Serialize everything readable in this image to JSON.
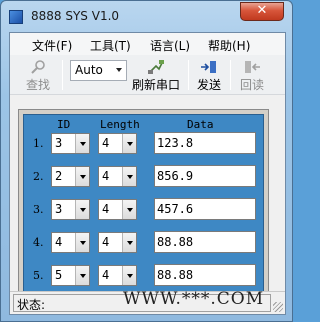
{
  "window": {
    "title": "8888 SYS V1.0",
    "close_glyph": "✕"
  },
  "menu": {
    "items": [
      "文件(F)",
      "工具(T)",
      "语言(L)",
      "帮助(H)"
    ]
  },
  "toolbar": {
    "find_label": "查找",
    "baud_value": "Auto",
    "refresh_label": "刷新串口",
    "send_label": "发送",
    "readback_label": "回读"
  },
  "table": {
    "headers": {
      "id": "ID",
      "length": "Length",
      "data": "Data"
    },
    "rows": [
      {
        "num": "1.",
        "id": "3",
        "length": "4",
        "data": "123.8"
      },
      {
        "num": "2.",
        "id": "2",
        "length": "4",
        "data": "856.9"
      },
      {
        "num": "3.",
        "id": "3",
        "length": "4",
        "data": "457.6"
      },
      {
        "num": "4.",
        "id": "4",
        "length": "4",
        "data": "88.88"
      },
      {
        "num": "5.",
        "id": "5",
        "length": "4",
        "data": "88.88"
      }
    ]
  },
  "status": {
    "label": "状态:"
  },
  "watermark": "WWW.***.COM",
  "colors": {
    "panel_blue": "#3e88c4",
    "close_red": "#c0391f",
    "desktop": "#5aa0d8"
  },
  "icons": [
    "app-icon",
    "search-icon",
    "refresh-port-icon",
    "send-icon",
    "readback-icon",
    "close-icon"
  ]
}
